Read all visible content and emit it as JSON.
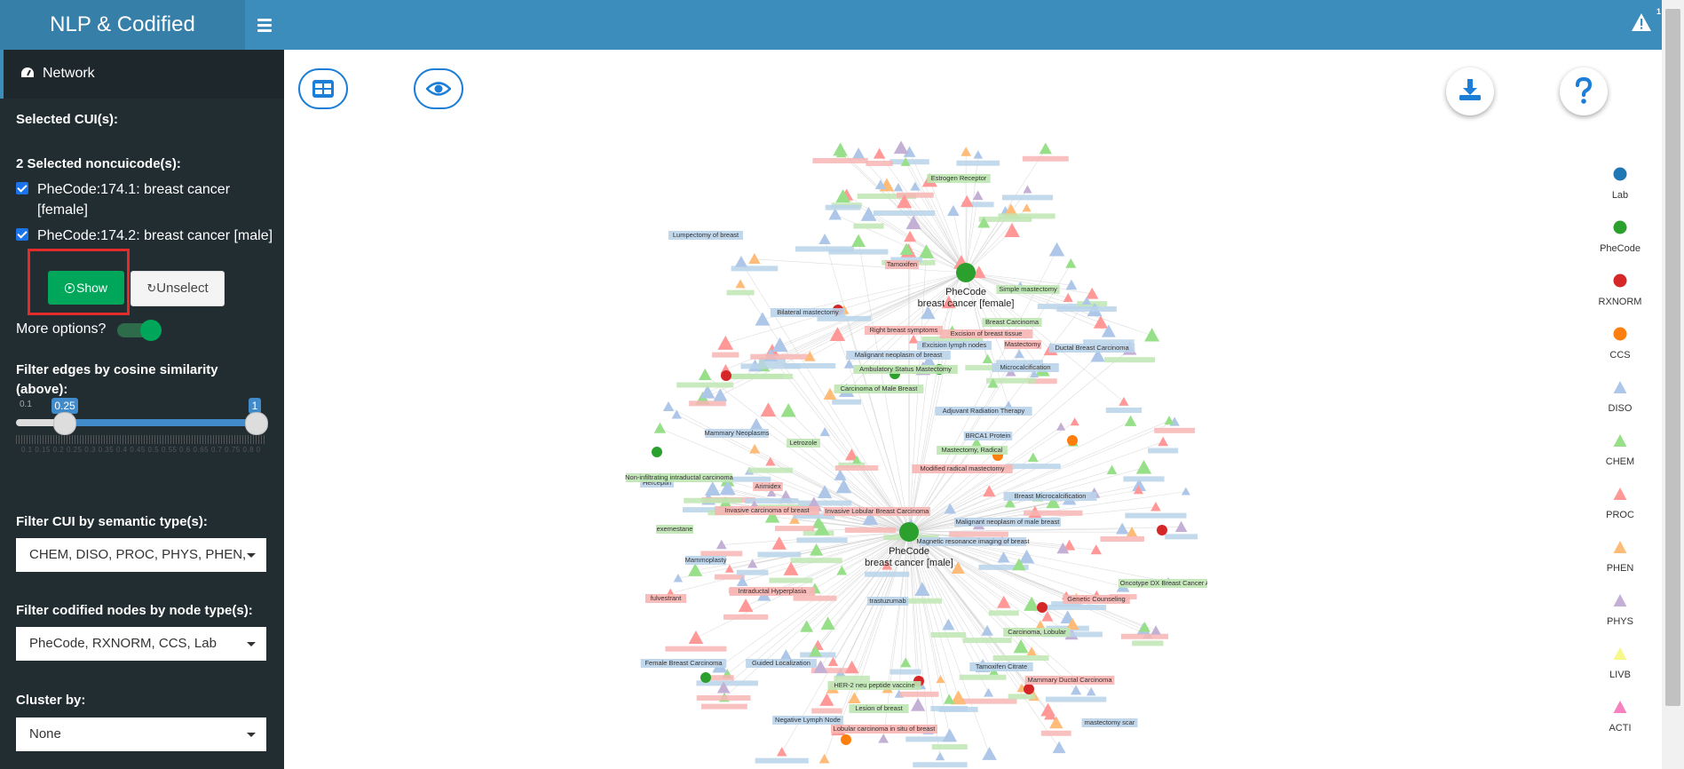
{
  "header": {
    "brand": "NLP & Codified",
    "alert_count": "1"
  },
  "sidebar": {
    "nav_label": "Network",
    "selected_cuis_label": "Selected CUI(s):",
    "selected_noncui_label": "2 Selected noncuicode(s):",
    "codes": [
      {
        "label": "PheCode:174.1: breast cancer [female]",
        "checked": true
      },
      {
        "label": "PheCode:174.2: breast cancer [male]",
        "checked": true
      }
    ],
    "show_button": "Show",
    "unselect_button": "Unselect",
    "more_options_label": "More options?",
    "more_options_on": true,
    "filter_edges_label": "Filter edges by cosine similarity (above):",
    "slider": {
      "min": "0.1",
      "value": "0.25",
      "max": "1",
      "tick_labels": "0.1 0.15 0.2 0.25 0.3 0.35 0.4 0.45 0.5 0.55 0.6 0.65 0.7 0.75 0.8 0.85 0.9 0.95 1"
    },
    "filter_semantic_label": "Filter CUI by semantic type(s):",
    "filter_semantic_value": "CHEM, DISO, PROC, PHYS, PHEN, ACTI",
    "filter_codified_label": "Filter codified nodes by node type(s):",
    "filter_codified_value": "PheCode, RXNORM, CCS, Lab",
    "cluster_label": "Cluster by:",
    "cluster_value": "None"
  },
  "toolbar": {
    "table_icon": "table-icon",
    "eye_icon": "eye-icon",
    "download_icon": "download-icon",
    "help_icon": "question-icon"
  },
  "legend": [
    {
      "label": "Lab",
      "shape": "dot",
      "color": "#1f77b4"
    },
    {
      "label": "PheCode",
      "shape": "dot",
      "color": "#2ca02c"
    },
    {
      "label": "RXNORM",
      "shape": "dot",
      "color": "#d62728"
    },
    {
      "label": "CCS",
      "shape": "dot",
      "color": "#ff7f0e"
    },
    {
      "label": "DISO",
      "shape": "triangle",
      "color": "#aec7e8"
    },
    {
      "label": "CHEM",
      "shape": "triangle",
      "color": "#98df8a"
    },
    {
      "label": "PROC",
      "shape": "triangle",
      "color": "#ff9896"
    },
    {
      "label": "PHEN",
      "shape": "triangle",
      "color": "#ffbb78"
    },
    {
      "label": "PHYS",
      "shape": "triangle",
      "color": "#c5b0d5"
    },
    {
      "label": "LIVB",
      "shape": "triangle",
      "color": "#f7f78a"
    },
    {
      "label": "ACTI",
      "shape": "triangle",
      "color": "#f781bf"
    }
  ],
  "network": {
    "hub_female": {
      "code": "PheCode",
      "label": "breast cancer [female]"
    },
    "hub_male": {
      "code": "PheCode",
      "label": "breast cancer [male]"
    },
    "labels": [
      "Lumpectomy of breast",
      "Simple mastectomy",
      "Tamoxifen",
      "Bilateral mastectomy",
      "Estrogen Receptor",
      "Mastectomy",
      "Ductal Breast Carcinoma",
      "Malignant neoplasm of breast",
      "Carcinoma of Male Breast",
      "Invasive carcinoma of breast",
      "Malignant neoplasm of male breast",
      "Mastectomy, Radical",
      "Modified radical mastectomy",
      "Magnetic resonance imaging of breast",
      "Mammary Neoplasms",
      "Letrozole",
      "Arimidex",
      "Herceptin",
      "Non-infiltrating intraductal carcinoma",
      "Intraductal Hyperplasia",
      "Female Breast Carcinoma",
      "Guided Localization",
      "HER-2 neu peptide vaccine",
      "Lobular carcinoma in situ of breast",
      "Tamoxifen Citrate",
      "Carcinoma, Lobular",
      "Mammary Ductal Carcinoma",
      "Negative Lymph Node",
      "trastuzumab",
      "exemestane",
      "fulvestrant",
      "Mammoplasty",
      "Breast Carcinoma",
      "Excision of breast tissue",
      "Breast Microcalcification",
      "BRCA1 Protein",
      "Oncotype DX Breast Cancer Assay",
      "Genetic Counseling",
      "mastectomy scar",
      "Lesion of breast",
      "Invasive Lobular Breast Carcinoma",
      "Adjuvant Radiation Therapy",
      "Excision lymph nodes",
      "Ambulatory Status Mastectomy",
      "Right breast symptoms",
      "Microcalcification"
    ]
  }
}
